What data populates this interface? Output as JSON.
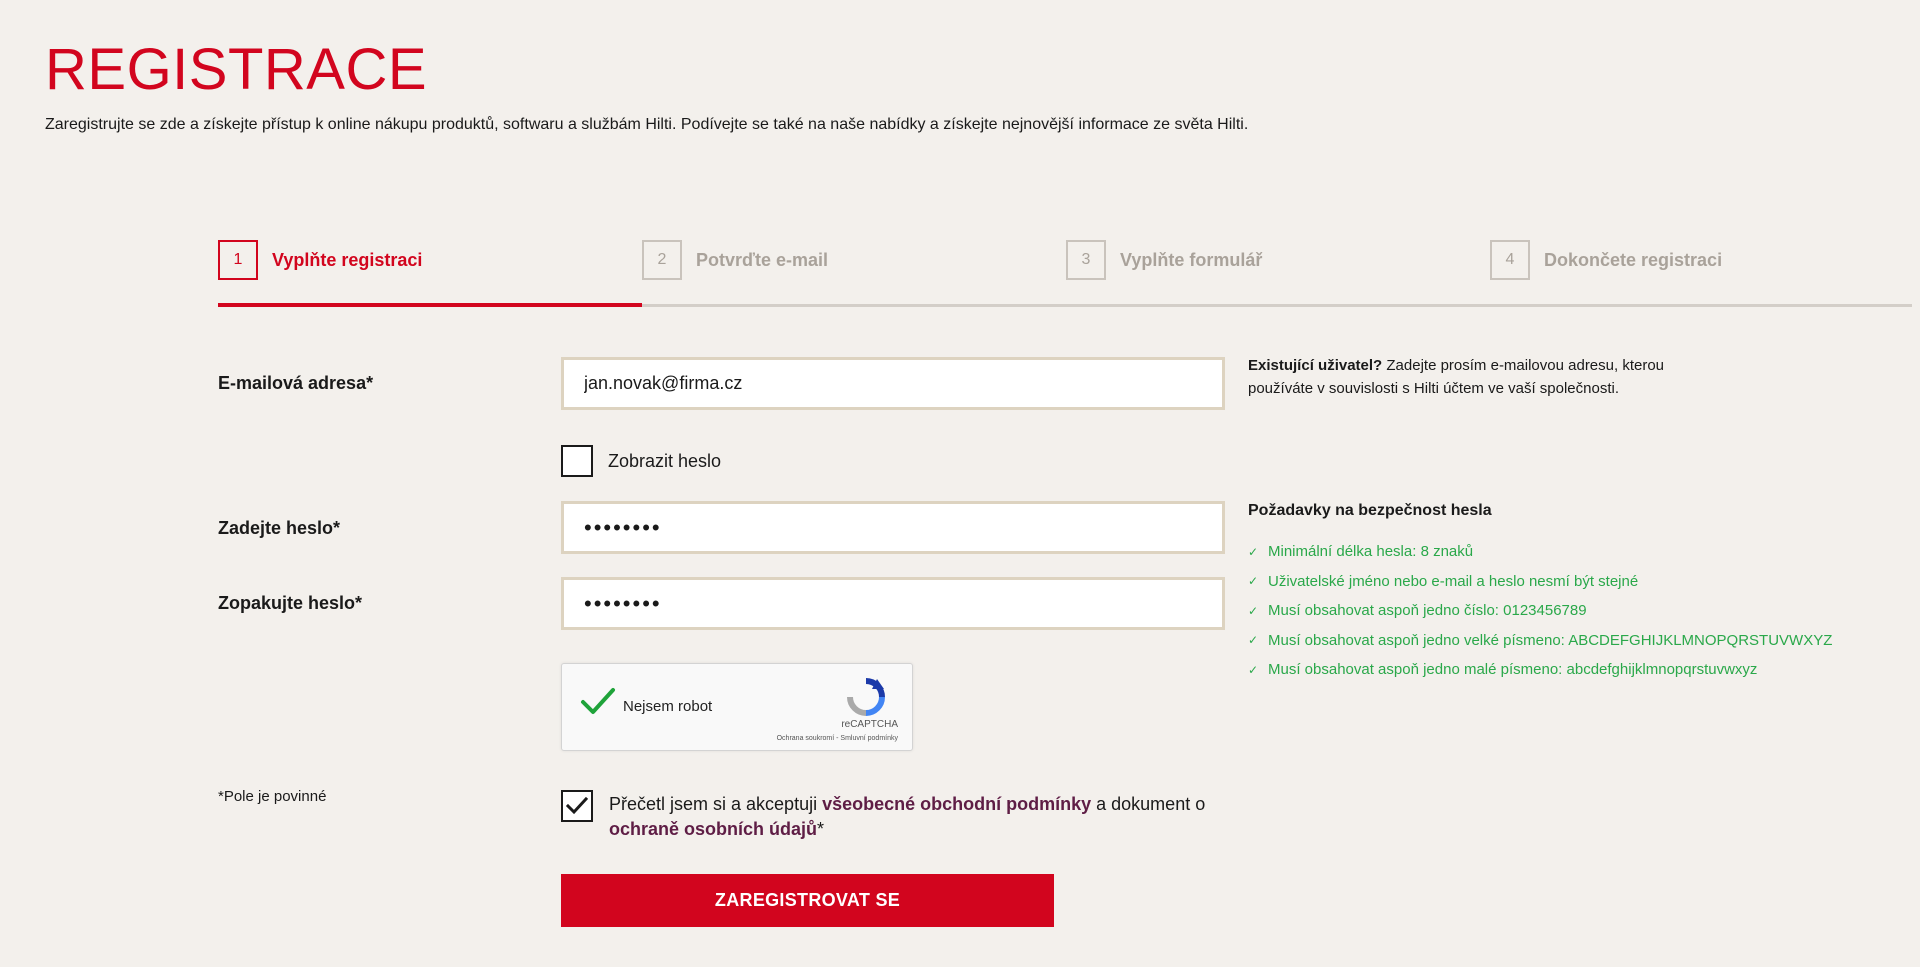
{
  "page": {
    "title": "REGISTRACE",
    "intro": "Zaregistrujte se zde a získejte přístup k online nákupu produktů, softwaru a službám Hilti. Podívejte se také na naše nabídky a získejte nejnovější informace ze světa Hilti."
  },
  "stepper": {
    "active_step": 1,
    "steps": [
      {
        "num": "1",
        "label": "Vyplňte registraci"
      },
      {
        "num": "2",
        "label": "Potvrďte e-mail"
      },
      {
        "num": "3",
        "label": "Vyplňte formulář"
      },
      {
        "num": "4",
        "label": "Dokončete registraci"
      }
    ]
  },
  "form": {
    "email_label": "E-mailová adresa*",
    "email_value": "jan.novak@firma.cz",
    "show_password_label": "Zobrazit heslo",
    "show_password_checked": false,
    "password_label": "Zadejte heslo*",
    "password_value": "••••••••",
    "password_repeat_label": "Zopakujte heslo*",
    "password_repeat_value": "••••••••",
    "captcha": {
      "label": "Nejsem robot",
      "brand": "reCAPTCHA",
      "links": "Ochrana soukromí - Smluvní podmínky",
      "checked": true
    },
    "required_note": "*Pole je povinné",
    "terms": {
      "checked": true,
      "text_1": "Přečetl jsem si a akceptuji ",
      "link_1": "všeobecné obchodní podmínky",
      "text_2": " a dokument o ",
      "link_2": "ochraně osobních údajů",
      "text_3": "*"
    },
    "submit_label": "ZAREGISTROVAT SE"
  },
  "info": {
    "existing_bold": "Existující uživatel?",
    "existing_text": " Zadejte prosím e-mailovou adresu, kterou používáte v souvislosti s Hilti účtem ve vaší společnosti.",
    "requirements_title": "Požadavky na bezpečnost hesla",
    "requirements": [
      "Minimální délka hesla: 8 znaků",
      "Uživatelské jméno nebo e-mail a heslo nesmí být stejné",
      "Musí obsahovat aspoň jedno číslo: 0123456789",
      "Musí obsahovat aspoň jedno velké písmeno: ABCDEFGHIJKLMNOPQRSTUVWXYZ",
      "Musí obsahovat aspoň jedno malé písmeno: abcdefghijklmnopqrstuvwxyz"
    ]
  },
  "colors": {
    "brand_red": "#d2051e",
    "success_green": "#2aa84a",
    "link_purple": "#5e1d45",
    "background": "#f3f0ec"
  }
}
